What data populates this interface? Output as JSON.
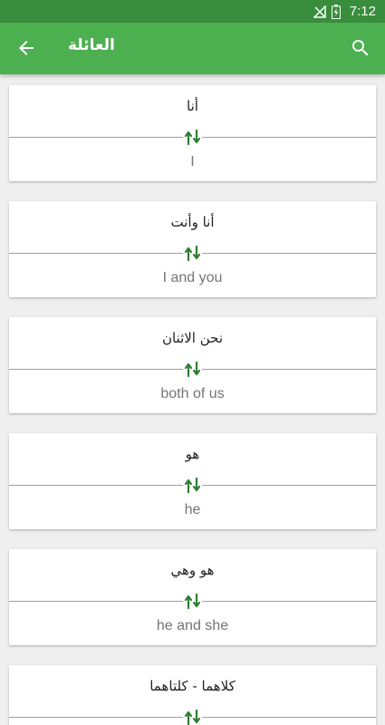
{
  "status_bar": {
    "time": "7:12"
  },
  "app_bar": {
    "title": "العائلة"
  },
  "phrases": [
    {
      "arabic": "أنا",
      "english": "I"
    },
    {
      "arabic": "أنا وأنت",
      "english": "I and you"
    },
    {
      "arabic": "نحن الاثنان",
      "english": "both of us"
    },
    {
      "arabic": "هو",
      "english": "he"
    },
    {
      "arabic": "هو وهي",
      "english": "he and she"
    },
    {
      "arabic": "كلاهما - كلتاهما",
      "english": ""
    }
  ],
  "colors": {
    "primary": "#4caf50",
    "primary_dark": "#388e3c",
    "accent": "#2e7d32"
  },
  "icons": {
    "back": "arrow-back-icon",
    "search": "search-icon",
    "swap": "swap-vertical-icon"
  }
}
